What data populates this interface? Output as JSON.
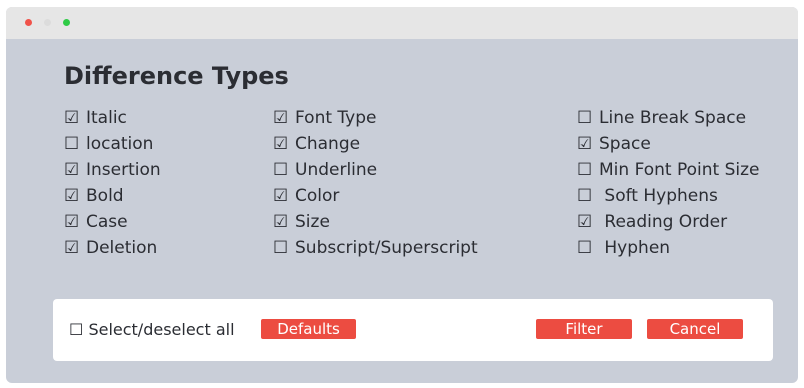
{
  "window": {
    "controls": [
      "close",
      "minimize",
      "maximize"
    ]
  },
  "dialog": {
    "title": "Difference Types"
  },
  "columns": [
    {
      "items": [
        {
          "box": "☑",
          "label": "Italic"
        },
        {
          "box": "☐",
          "label": "location"
        },
        {
          "box": "☑",
          "label": "Insertion"
        },
        {
          "box": "☑",
          "label": "Bold"
        },
        {
          "box": "☑",
          "label": "Case"
        },
        {
          "box": "☑",
          "label": "Deletion"
        }
      ]
    },
    {
      "items": [
        {
          "box": "☑",
          "label": "Font Type"
        },
        {
          "box": "☑",
          "label": "Change"
        },
        {
          "box": "☐",
          "label": "Underline"
        },
        {
          "box": "☑",
          "label": "Color"
        },
        {
          "box": "☑",
          "label": "Size"
        },
        {
          "box": "☐",
          "label": "Subscript/Superscript"
        }
      ]
    },
    {
      "items": [
        {
          "box": "☐",
          "label": "Line Break Space"
        },
        {
          "box": "☑",
          "label": "Space"
        },
        {
          "box": "☐",
          "label": "Min Font Point Size"
        },
        {
          "box": "☐",
          "label": " Soft Hyphens"
        },
        {
          "box": "☑",
          "label": " Reading Order"
        },
        {
          "box": "☐",
          "label": " Hyphen"
        }
      ]
    }
  ],
  "footer": {
    "select_all_box": "☐",
    "select_all_label": "Select/deselect all",
    "defaults_label": "Defaults",
    "filter_label": "Filter",
    "cancel_label": "Cancel"
  },
  "colors": {
    "accent": "#ec4c41",
    "dialog_bg": "#c9ced8",
    "titlebar_bg": "#e6e6e6",
    "close_dot": "#f0524a",
    "minimize_dot": "#dcdcdc",
    "maximize_dot": "#2fcb46"
  }
}
